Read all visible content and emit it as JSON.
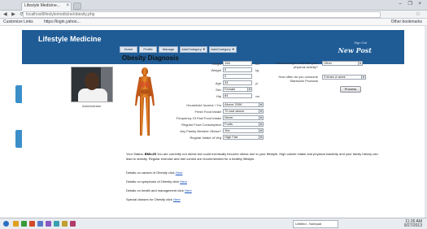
{
  "browser": {
    "tab_title": "Lifestyle Medicine...",
    "tab_close": "×",
    "window_controls": "– ❐ ×",
    "nav_buttons": "◀ ▶ ⟳",
    "url": "localhost/lifestylemedicine/obesity.php",
    "bookmarks": [
      "Customize Links",
      "https://login.yahoo..."
    ],
    "bookmark_right": "Other bookmarks"
  },
  "site": {
    "brand": "Lifestyle Medicine",
    "login_link": "Sign Out",
    "new_post": "New Post",
    "nav_tabs": [
      "Home",
      "Profile",
      "Manage",
      "Add/Category ▼",
      "Add/Category ▼"
    ]
  },
  "profile": {
    "caption": "Administrator"
  },
  "form": {
    "title": "Obesity Diagnosis",
    "height_label": "Height",
    "height_value": "158",
    "height_unit": "cm",
    "weight_label": "Weight",
    "weight_value": "0",
    "weight_unit": "kg",
    "waist_label": "",
    "waist_value": "0",
    "age_label": "Age",
    "age_value": "34",
    "age_unit": "yr",
    "sex_label": "Sex",
    "sex_value": "Female",
    "hip_label": "Hip",
    "hip_value": "84",
    "hip_unit": "cm",
    "income_label": "Household Income / Yrs",
    "income_value": "Above 200K",
    "food_label": "Fresh Food Intake",
    "food_value": "70 and above",
    "fastfood_label": "Frequency Of Fast Food Intake",
    "fastfood_value": "Never",
    "computer_label": "Regular Food Consumption",
    "computer_value": "Fruits",
    "family_label": "Any Family Member Obese?",
    "family_value": "Yes",
    "vegetable_label": "Regular Intake of Veg",
    "vegetable_value": "High Fiat",
    "activity_label": "How would you describe your physical activity?",
    "activity_value": "Other",
    "hours_label": "How often do you consume Starbucks Products",
    "hours_value": "3 times a week",
    "process_button": "Process"
  },
  "result": {
    "prefix": "Your Status:",
    "bmi": "BMI=25",
    "text": "You are currently not obese but could eventually become obese due to your lifestyle. High calorie intake and physical inactivity and your family history can lead to obesity. Regular exercise and diet control are recommended for a healthy lifestyle."
  },
  "links": [
    {
      "text": "Details on causes of Obesity click",
      "go": "Here"
    },
    {
      "text": "Details on symptoms of Obesity click",
      "go": "Here"
    },
    {
      "text": "Details on health and management click",
      "go": "Here"
    },
    {
      "text": "Special classes for Obesity click",
      "go": "Here"
    }
  ],
  "taskbar": {
    "window_label": "Untitled - Notepad",
    "time": "11:26 AM",
    "date": "9/27/2013"
  },
  "colors": {
    "banner": "#1f5c96",
    "side_badge": "#3b8fc9",
    "link": "#1a55c0"
  }
}
